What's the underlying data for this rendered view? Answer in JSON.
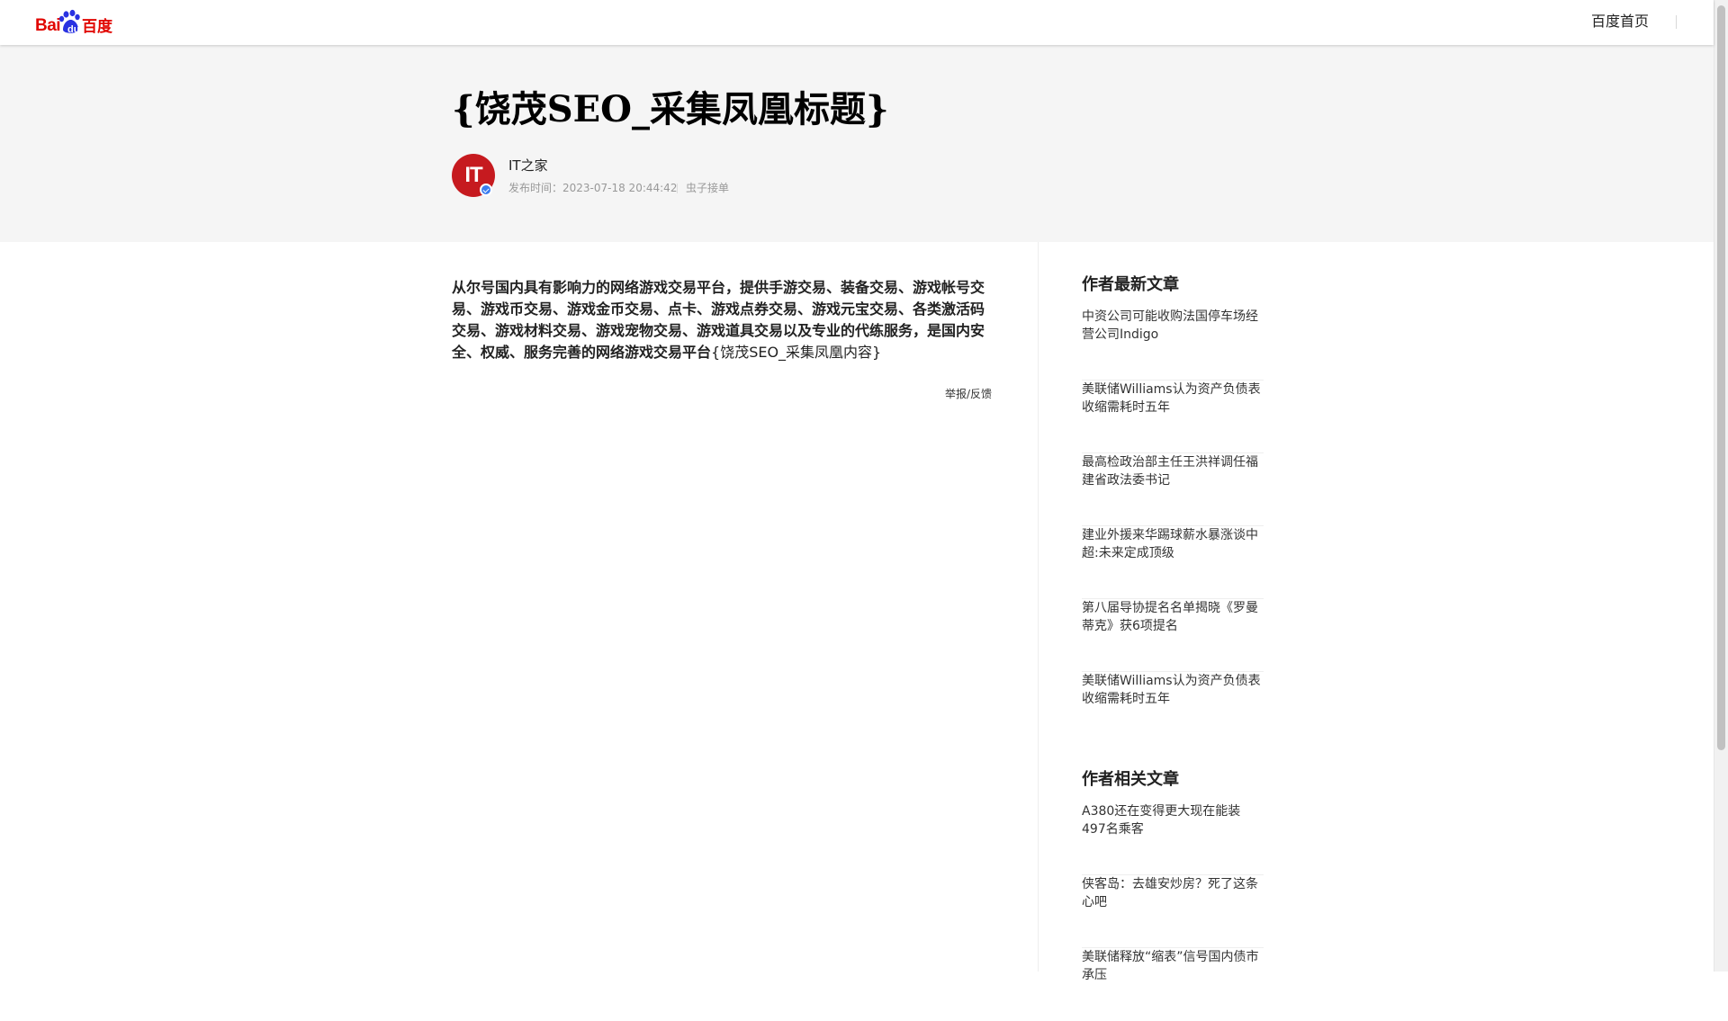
{
  "topbar": {
    "logo_bai": "Bai",
    "logo_du": "du",
    "logo_cn": "百度",
    "home_link": "百度首页"
  },
  "article": {
    "title": "{饶茂SEO_采集凤凰标题}",
    "author": "IT之家",
    "avatar_text": "IT",
    "publish_time": "发布时间：2023-07-18 20:44:42",
    "source": "虫子接单",
    "body_bold": "从尔号国内具有影响力的网络游戏交易平台，提供手游交易、装备交易、游戏帐号交易、游戏币交易、游戏金币交易、点卡、游戏点券交易、游戏元宝交易、各类激活码交易、游戏材料交易、游戏宠物交易、游戏道具交易以及专业的代练服务，是国内安全、权威、服务完善的网络游戏交易平台",
    "body_normal": "{饶茂SEO_采集凤凰内容}",
    "report": "举报/反馈"
  },
  "sidebar": {
    "latest_heading": "作者最新文章",
    "latest": [
      "中资公司可能收购法国停车场经营公司Indigo",
      "美联储Williams认为资产负债表收缩需耗时五年",
      "最高检政治部主任王洪祥调任福建省政法委书记",
      "建业外援来华踢球薪水暴涨谈中超:未来定成顶级",
      "第八届导协提名名单揭晓《罗曼蒂克》获6项提名",
      "美联储Williams认为资产负债表收缩需耗时五年"
    ],
    "related_heading": "作者相关文章",
    "related": [
      "A380还在变得更大现在能装497名乘客",
      "侠客岛：去雄安炒房？死了这条心吧",
      "美联储释放“缩表”信号国内债市承压"
    ]
  },
  "colors": {
    "brand_red": "#e10601",
    "brand_blue": "#2932e1",
    "avatar_red": "#c61a1f",
    "verified_blue": "#3a7cf0",
    "header_band": "#f5f5f5"
  }
}
